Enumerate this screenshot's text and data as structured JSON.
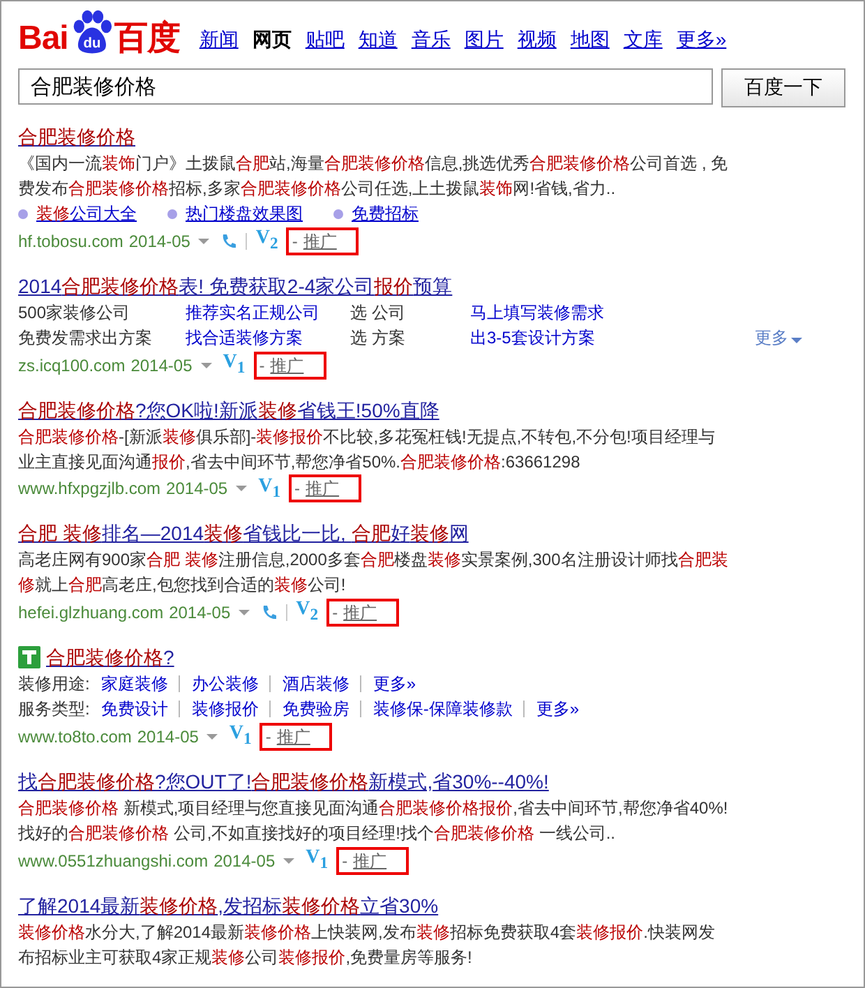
{
  "logo": {
    "left": "Bai",
    "paw": "du",
    "right": "百度"
  },
  "tabs": [
    {
      "label": "新闻",
      "selected": false
    },
    {
      "label": "网页",
      "selected": true
    },
    {
      "label": "贴吧",
      "selected": false
    },
    {
      "label": "知道",
      "selected": false
    },
    {
      "label": "音乐",
      "selected": false
    },
    {
      "label": "图片",
      "selected": false
    },
    {
      "label": "视频",
      "selected": false
    },
    {
      "label": "地图",
      "selected": false
    },
    {
      "label": "文库",
      "selected": false
    },
    {
      "label": "更多»",
      "selected": false
    }
  ],
  "search": {
    "value": "合肥装修价格",
    "button": "百度一下"
  },
  "results": [
    {
      "kind": "snippet",
      "title": "**合肥装修价格**",
      "title_icon": false,
      "snippet": "《国内一流**装饰**门户》土拨鼠**合肥**站,海量**合肥装修价格**信息,挑选优秀**合肥装修价格**公司首选 , 免费发布**合肥装修价格**招标,多家**合肥装修价格**公司任选,上土拨鼠**装饰**网!省钱,省力..",
      "sitelinks": [
        "**装修**公司大全",
        "热门楼盘效果图",
        "免费招标"
      ],
      "url": "hf.tobosu.com",
      "date": "2014-05",
      "phone": true,
      "vip": "V$_{2}$",
      "dash": "-",
      "promo": "推广"
    },
    {
      "kind": "grid",
      "title": "2014**合肥装修价格**表! 免费获取2-4家公司**报价**预算",
      "title_icon": false,
      "grid": [
        [
          "500家装修公司",
          "推荐实名正规公司",
          "选 公司",
          "马上填写装修需求"
        ],
        [
          "免费发需求出方案",
          "找合适装修方案",
          "选 方案",
          "出3-5套设计方案"
        ]
      ],
      "more": "更多",
      "url": "zs.icq100.com",
      "date": "2014-05",
      "phone": false,
      "vip": "V$_{1}$",
      "dash": "-",
      "promo": "推广"
    },
    {
      "kind": "snippet",
      "title": "**合肥装修价格**?您OK啦!新派**装修**省钱王!50%直降",
      "title_icon": false,
      "snippet": "**合肥装修价格**-[新派**装修**俱乐部]-**装修报价**不比较,多花冤枉钱!无提点,不转包,不分包!项目经理与业主直接见面沟通**报价**,省去中间环节,帮您净省50%.**合肥装修价格**:63661298",
      "url": "www.hfxpgzjlb.com",
      "date": "2014-05",
      "phone": false,
      "vip": "V$_{1}$",
      "dash": "-",
      "promo": "推广"
    },
    {
      "kind": "snippet",
      "title": "**合肥 装修**排名—2014**装修**省钱比一比, **合肥**好**装修**网",
      "title_icon": false,
      "snippet": "高老庄网有900家**合肥 装修**注册信息,2000多套**合肥**楼盘**装修**实景案例,300名注册设计师找**合肥装修**就上**合肥**高老庄,包您找到合适的**装修**公司!",
      "url": "hefei.glzhuang.com",
      "date": "2014-05",
      "phone": true,
      "vip": "V$_{2}$",
      "dash": "-",
      "promo": "推广"
    },
    {
      "kind": "categories",
      "title": "**合肥装修价格**?",
      "title_icon": true,
      "categories": [
        {
          "label": "装修用途:",
          "links": [
            "家庭装修",
            "办公装修",
            "酒店装修",
            "更多»"
          ]
        },
        {
          "label": "服务类型:",
          "links": [
            "免费设计",
            "装修报价",
            "免费验房",
            "装修保-保障装修款",
            "更多»"
          ]
        }
      ],
      "url": "www.to8to.com",
      "date": "2014-05",
      "phone": false,
      "vip": "V$_{1}$",
      "dash": "-",
      "promo": "推广"
    },
    {
      "kind": "snippet",
      "title": "找**合肥装修价格**?您OUT了!**合肥装修价格**新模式,省30%--40%!",
      "title_icon": false,
      "snippet": "**合肥装修价格** 新模式,项目经理与您直接见面沟通**合肥装修价格报价**,省去中间环节,帮您净省40%!找好的**合肥装修价格** 公司,不如直接找好的项目经理!找个**合肥装修价格** 一线公司..",
      "url": "www.0551zhuangshi.com",
      "date": "2014-05",
      "phone": false,
      "vip": "V$_{1}$",
      "dash": "-",
      "promo": "推广"
    },
    {
      "kind": "snippet",
      "title": "了解2014最新**装修价格**,发招标**装修价格**立省30%",
      "title_icon": false,
      "snippet": "**装修价格**水分大,了解2014最新**装修价格**上快装网,发布**装修**招标免费获取4套**装修报价**.快装网发布招标业主可获取4家正规**装修**公司**装修报价**,免费量房等服务!"
    }
  ]
}
